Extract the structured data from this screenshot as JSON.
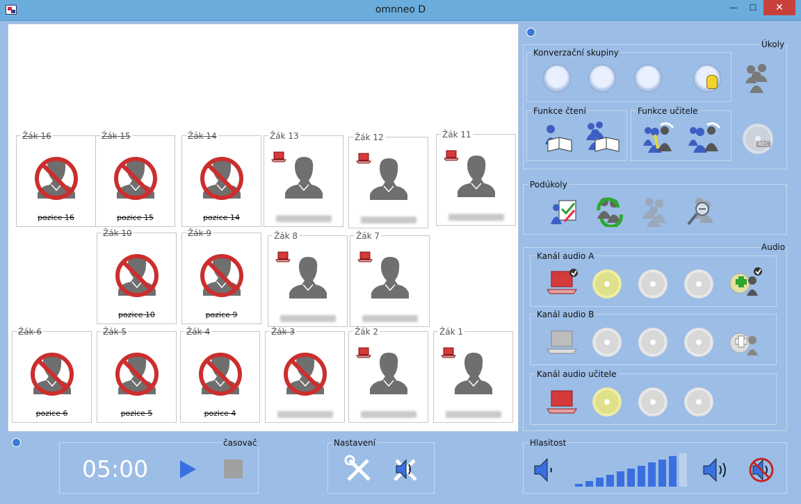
{
  "window": {
    "title": "omnneo D",
    "min_label": "—",
    "max_label": "☐",
    "close_label": "✕"
  },
  "seats": [
    {
      "label": "Žák 16",
      "status": "absent",
      "position": "pozice 16"
    },
    {
      "label": "Žák 15",
      "status": "absent",
      "position": "pozice 15"
    },
    {
      "label": "Žák 14",
      "status": "absent",
      "position": "pozice 14"
    },
    {
      "label": "Žák 13",
      "status": "present",
      "position": ""
    },
    {
      "label": "Žák 12",
      "status": "present",
      "position": ""
    },
    {
      "label": "Žák 11",
      "status": "present",
      "position": ""
    },
    {
      "label": "Žák 10",
      "status": "absent",
      "position": "pozice 10"
    },
    {
      "label": "Žák 9",
      "status": "absent",
      "position": "pozice 9"
    },
    {
      "label": "Žák 8",
      "status": "present",
      "position": ""
    },
    {
      "label": "Žák 7",
      "status": "present",
      "position": ""
    },
    {
      "label": "Žák 6",
      "status": "absent",
      "position": "pozice 6"
    },
    {
      "label": "Žák 5",
      "status": "absent",
      "position": "pozice 5"
    },
    {
      "label": "Žák 4",
      "status": "absent",
      "position": "pozice 4"
    },
    {
      "label": "Žák 3",
      "status": "absent",
      "position": ""
    },
    {
      "label": "Žák 2",
      "status": "present",
      "position": ""
    },
    {
      "label": "Žák 1",
      "status": "present",
      "position": ""
    }
  ],
  "tasks": {
    "title": "Úkoly",
    "conversation_groups": "Konverzační skupiny",
    "reading": "Funkce čtení",
    "teacher": "Funkce učitele",
    "rec_label": "REC"
  },
  "subtasks": {
    "title": "Podúkoly"
  },
  "audio": {
    "title": "Audio",
    "channel_a": "Kanál audio A",
    "channel_b": "Kanál audio B",
    "channel_teacher": "Kanál audio učitele"
  },
  "timer": {
    "title": "časovač",
    "value": "05:00"
  },
  "settings": {
    "title": "Nastavení"
  },
  "volume": {
    "title": "Hlasitost",
    "level": 0.9
  },
  "colors": {
    "accent": "#3a6fe0",
    "absent": "#cc2e2e",
    "laptop": "#d43a3a",
    "avatar": "#6f6f6f"
  }
}
